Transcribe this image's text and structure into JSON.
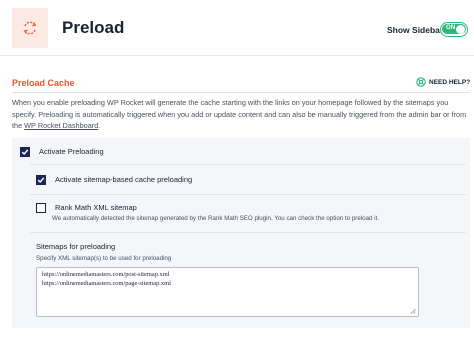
{
  "header": {
    "icon": "refresh-cycle-icon",
    "title": "Preload",
    "sidebar_label": "Show Sidebar",
    "toggle_label": "ON",
    "toggle_state": "on",
    "accent_color": "#2fb87a"
  },
  "section": {
    "title": "Preload Cache",
    "title_color": "#f4522d",
    "help_label": "NEED HELP?",
    "help_icon": "help-circle-icon",
    "description_part1": "When you enable preloading WP Rocket will generate the cache starting with the links on your homepage followed by the sitemaps you specify. Preloading is automatically triggered when you add or update content and can also be manually triggered from the admin bar or from the ",
    "description_link": "WP Rocket Dashboard",
    "description_part2": "."
  },
  "options": {
    "activate_preloading": {
      "label": "Activate Preloading",
      "checked": true
    },
    "sitemap_preloading": {
      "label": "Activate sitemap-based cache preloading",
      "checked": true
    },
    "rank_math": {
      "label": "Rank Math XML sitemap",
      "checked": false,
      "description": "We automatically detected the sitemap generated by the Rank Math SEO plugin. You can check the option to preload it."
    }
  },
  "sitemaps": {
    "title": "Sitemaps for preloading",
    "hint": "Specify XML sitemap(s) to be used for preloading",
    "value": "https://onlinemediamasters.com/post-sitemap.xml\nhttps://onlinemediamasters.com/page-sitemap.xml"
  }
}
